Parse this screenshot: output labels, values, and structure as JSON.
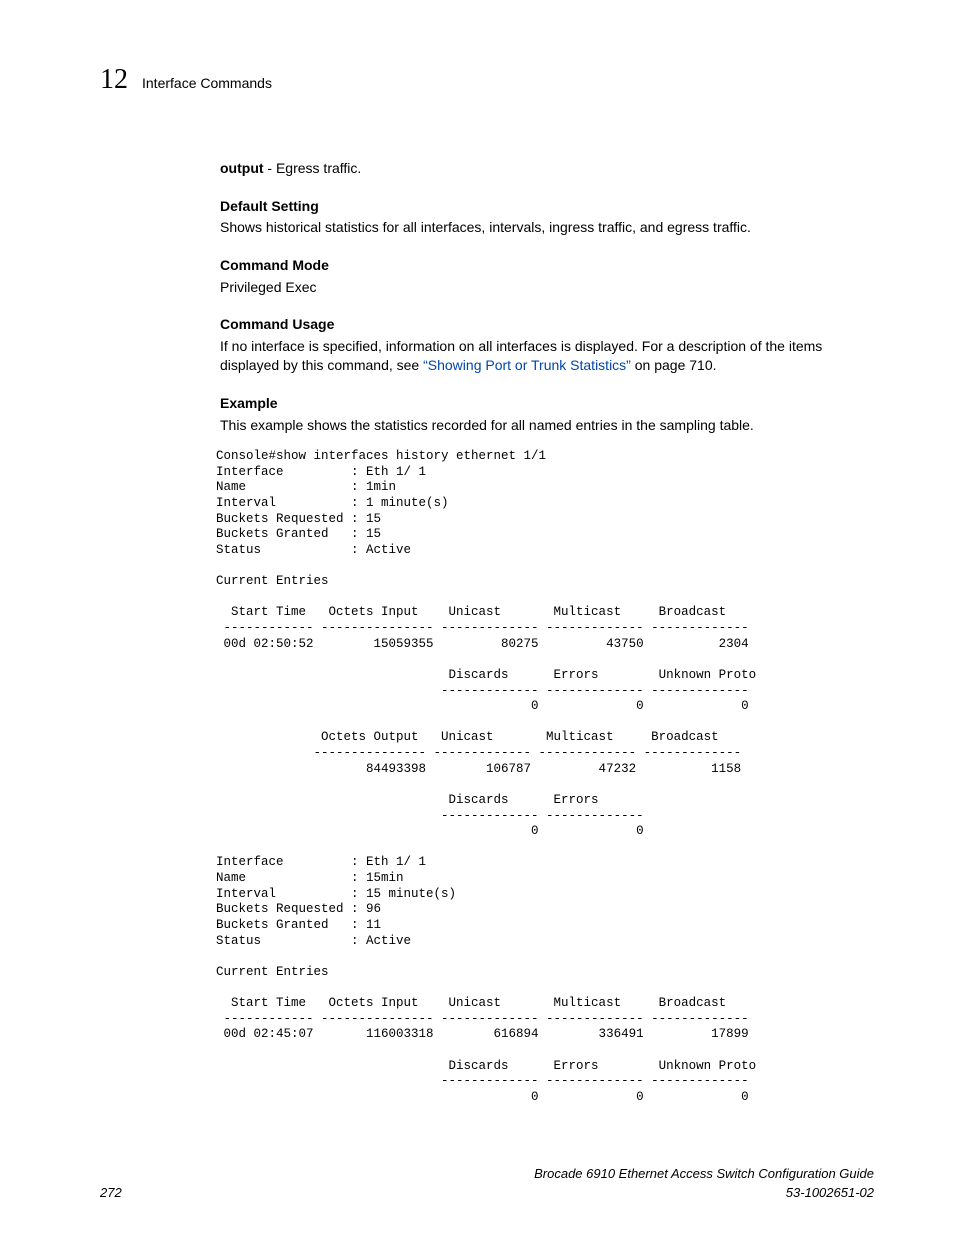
{
  "header": {
    "chapter_number": "12",
    "chapter_title": "Interface Commands"
  },
  "body": {
    "output_label": "output",
    "output_desc": " - Egress traffic.",
    "default_setting_title": "Default Setting",
    "default_setting_text": "Shows historical statistics for all interfaces, intervals, ingress traffic, and egress traffic.",
    "command_mode_title": "Command Mode",
    "command_mode_text": "Privileged Exec",
    "command_usage_title": "Command Usage",
    "command_usage_text_1": "If no interface is specified, information on all interfaces is displayed. For a description of the items displayed by this command, see ",
    "command_usage_link": "“Showing Port or Trunk Statistics”",
    "command_usage_text_2": " on page 710.",
    "example_title": "Example",
    "example_text": "This example shows the statistics recorded for all named entries in the sampling table.",
    "console_output": "Console#show interfaces history ethernet 1/1\nInterface         : Eth 1/ 1\nName              : 1min\nInterval          : 1 minute(s)\nBuckets Requested : 15\nBuckets Granted   : 15\nStatus            : Active\n\nCurrent Entries\n\n  Start Time   Octets Input    Unicast       Multicast     Broadcast\n ------------ --------------- ------------- ------------- -------------\n 00d 02:50:52        15059355         80275         43750          2304\n\n                               Discards      Errors        Unknown Proto\n                              ------------- ------------- -------------\n                                          0             0             0\n\n              Octets Output   Unicast       Multicast     Broadcast\n             --------------- ------------- ------------- -------------\n                    84493398        106787         47232          1158\n\n                               Discards      Errors\n                              ------------- -------------\n                                          0             0\n\nInterface         : Eth 1/ 1\nName              : 15min\nInterval          : 15 minute(s)\nBuckets Requested : 96\nBuckets Granted   : 11\nStatus            : Active\n\nCurrent Entries\n\n  Start Time   Octets Input    Unicast       Multicast     Broadcast\n ------------ --------------- ------------- ------------- -------------\n 00d 02:45:07       116003318        616894        336491         17899\n\n                               Discards      Errors        Unknown Proto\n                              ------------- ------------- -------------\n                                          0             0             0"
  },
  "footer": {
    "page_number": "272",
    "book_title": "Brocade 6910 Ethernet Access Switch Configuration Guide",
    "doc_number": "53-1002651-02"
  }
}
